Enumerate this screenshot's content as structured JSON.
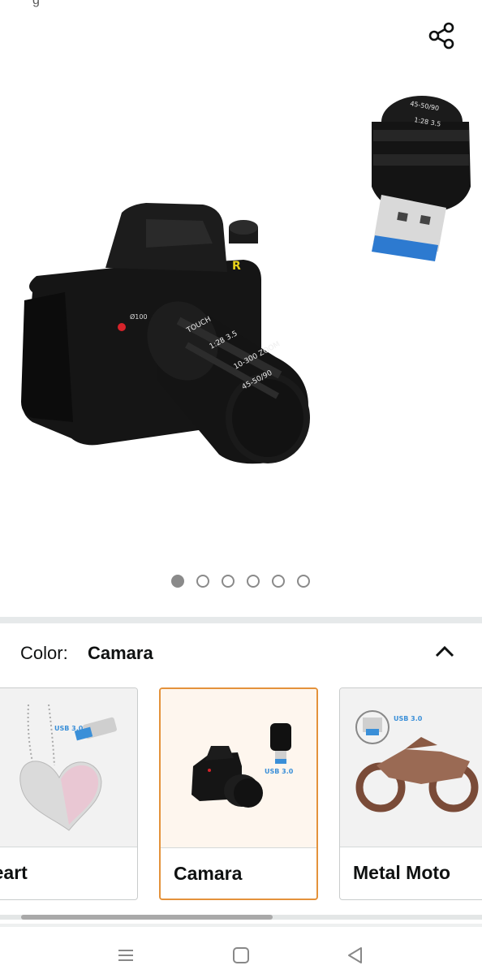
{
  "top_fragment": "g",
  "icons": {
    "share": "share-icon",
    "collapse": "chevron-up-icon",
    "recents": "recent-apps-icon",
    "home": "home-square-icon",
    "back": "back-triangle-icon"
  },
  "carousel": {
    "total_pages": 6,
    "active_page": 1
  },
  "color_selector": {
    "label": "Color:",
    "selected": "Camara"
  },
  "swatches": [
    {
      "label": "Heart",
      "badge": "USB 3.0",
      "selected": false
    },
    {
      "label": "Camara",
      "badge": "USB 3.0",
      "selected": true
    },
    {
      "label": "Metal Moto",
      "badge": "USB 3.0",
      "selected": false
    }
  ],
  "hero_image": {
    "lens_texts": [
      "45-50/90",
      "TOUCH",
      "10-300 ZOOM"
    ]
  },
  "colors": {
    "accent_selected": "#e4923b",
    "usb_blue": "#3a8fd8"
  }
}
